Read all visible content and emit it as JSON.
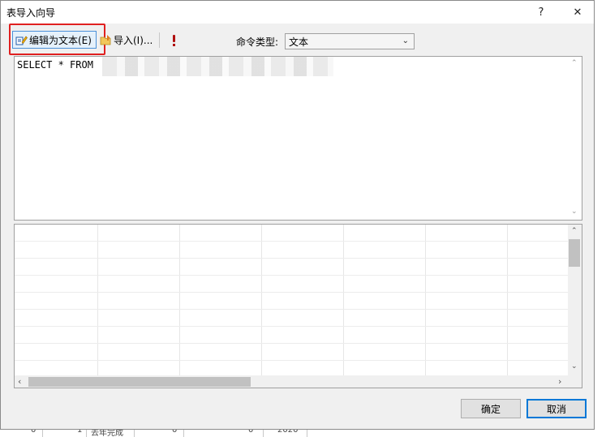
{
  "window": {
    "title": "表导入向导",
    "help": "?",
    "close": "✕"
  },
  "toolbar": {
    "edit_as_text": "编辑为文本(E)",
    "import": "导入(I)...",
    "command_type_label": "命令类型:",
    "command_type_value": "文本"
  },
  "editor": {
    "sql": "SELECT * FROM"
  },
  "footer": {
    "ok": "确定",
    "cancel": "取消"
  },
  "background_row": {
    "cells": [
      "0",
      "1",
      "去年完成",
      "0",
      "0",
      "2020"
    ]
  }
}
